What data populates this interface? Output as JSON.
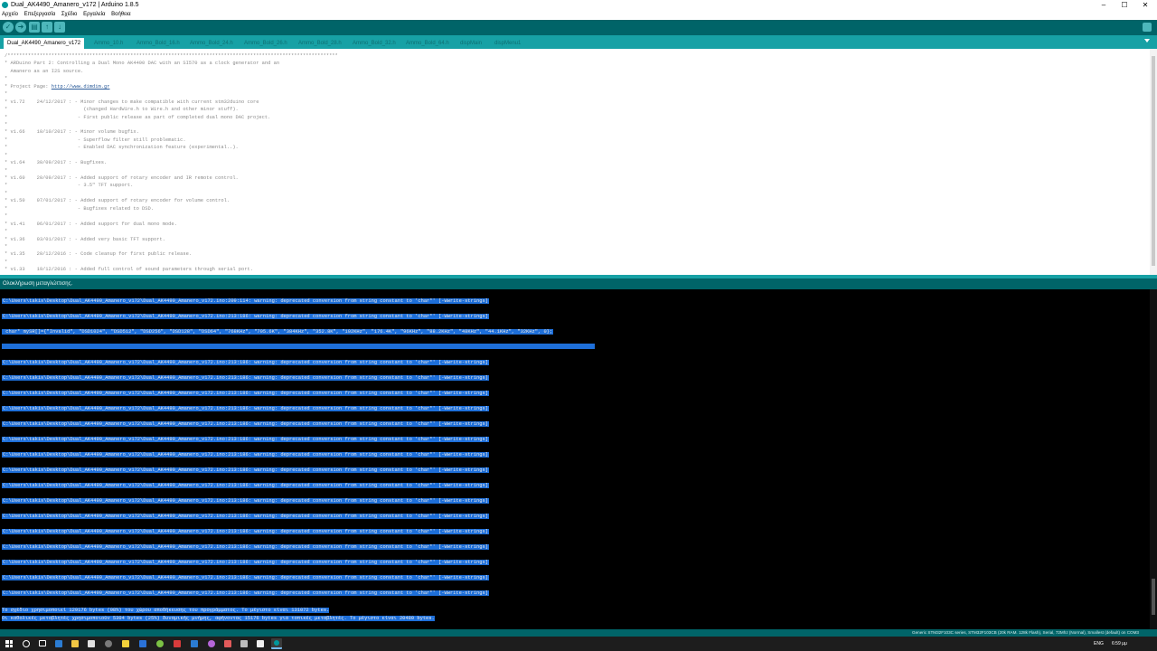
{
  "window": {
    "title": "Dual_AK4490_Amanero_v172 | Arduino 1.8.5",
    "controls": [
      "–",
      "☐",
      "✕"
    ]
  },
  "menu": [
    "Αρχείο",
    "Επεξεργασία",
    "Σχέδιο",
    "Εργαλεία",
    "Βοήθεια"
  ],
  "toolbar": {
    "verify": "✓",
    "upload": "➜",
    "new": "▤",
    "open": "↑",
    "save": "↓"
  },
  "tabs": [
    "Dual_AK4490_Amanero_v172",
    "Ammo_10.h",
    "Ammo_Bold_16.h",
    "Ammo_Bold_24.h",
    "Ammo_Bold_26.h",
    "Ammo_Bold_28.h",
    "Ammo_Bold_32.h",
    "Ammo_Bold_64.h",
    "dispMain",
    "dispMenu1"
  ],
  "code_lines": [
    "/*****************************************************************************************************************",
    "* ARDuino Part 2: Controlling a Dual Mono AK4490 DAC with an SI570 as a clock generator and an",
    "  Amanero as an I2S source.",
    "*",
    "* Project Page: ",
    "*",
    "* v1.72    24/12/2017 : - Minor changes to make compatible with current stm32duino core",
    "*                          (changed HardWire.h to Wire.h and other minor stuff).",
    "*                        - First public release as part of completed dual mono DAC project.",
    "*",
    "* v1.66    10/10/2017 : - Minor volume bugfix.",
    "*                        - Superflow filter still problematic.",
    "*                        - Enabled DAC synchronization feature (experimental..).",
    "*",
    "* v1.64    30/09/2017 : - Bugfixes.",
    "*",
    "* v1.60    20/09/2017 : - Added support of rotary encoder and IR remote control.",
    "*                        - 3.5\" TFT support.",
    "*",
    "* v1.50    07/01/2017 : - Added support of rotary encoder for volume control.",
    "*                        - Bugfixes related to DSD.",
    "*",
    "* v1.41    06/01/2017 : - Added support for dual mono mode.",
    "*",
    "* v1.36    03/01/2017 : - Added very basic TFT support.",
    "*",
    "* v1.35    20/12/2016 : - Code cleanup for first public release.",
    "*",
    "* v1.33    19/12/2016 : - Added full control of sound parameters through serial port."
  ],
  "project_link": "http://www.dimdim.gr",
  "status_message": "Ολοκλήρωση μεταγλώττισης.",
  "console_lines": [
    "C:\\Users\\takis\\Desktop\\Dual_AK4490_Amanero_v172\\Dual_AK4490_Amanero_v172.ino:209:114: warning: deprecated conversion from string constant to 'char*' [-Wwrite-strings]",
    "C:\\Users\\takis\\Desktop\\Dual_AK4490_Amanero_v172\\Dual_AK4490_Amanero_v172.ino:213:186: warning: deprecated conversion from string constant to 'char*' [-Wwrite-strings]",
    " char* mySR[]={\"Invalid\", \"DSD1024\", \"DSD512\", \"DSD256\", \"DSD128\", \"DSD64\", \"768KHz\", \"705.6K\", \"384KHz\", \"352.8K\", \"192KHz\", \"176.4K\", \"96KHz\", \"88.2KHz\", \"48KHz\", \"44.1KHz\", \"32KHz\", 0};",
    "",
    "C:\\Users\\takis\\Desktop\\Dual_AK4490_Amanero_v172\\Dual_AK4490_Amanero_v172.ino:213:186: warning: deprecated conversion from string constant to 'char*' [-Wwrite-strings]",
    "C:\\Users\\takis\\Desktop\\Dual_AK4490_Amanero_v172\\Dual_AK4490_Amanero_v172.ino:213:186: warning: deprecated conversion from string constant to 'char*' [-Wwrite-strings]",
    "C:\\Users\\takis\\Desktop\\Dual_AK4490_Amanero_v172\\Dual_AK4490_Amanero_v172.ino:213:186: warning: deprecated conversion from string constant to 'char*' [-Wwrite-strings]",
    "C:\\Users\\takis\\Desktop\\Dual_AK4490_Amanero_v172\\Dual_AK4490_Amanero_v172.ino:213:186: warning: deprecated conversion from string constant to 'char*' [-Wwrite-strings]",
    "C:\\Users\\takis\\Desktop\\Dual_AK4490_Amanero_v172\\Dual_AK4490_Amanero_v172.ino:213:186: warning: deprecated conversion from string constant to 'char*' [-Wwrite-strings]",
    "C:\\Users\\takis\\Desktop\\Dual_AK4490_Amanero_v172\\Dual_AK4490_Amanero_v172.ino:213:186: warning: deprecated conversion from string constant to 'char*' [-Wwrite-strings]",
    "C:\\Users\\takis\\Desktop\\Dual_AK4490_Amanero_v172\\Dual_AK4490_Amanero_v172.ino:213:186: warning: deprecated conversion from string constant to 'char*' [-Wwrite-strings]",
    "C:\\Users\\takis\\Desktop\\Dual_AK4490_Amanero_v172\\Dual_AK4490_Amanero_v172.ino:213:186: warning: deprecated conversion from string constant to 'char*' [-Wwrite-strings]",
    "C:\\Users\\takis\\Desktop\\Dual_AK4490_Amanero_v172\\Dual_AK4490_Amanero_v172.ino:213:186: warning: deprecated conversion from string constant to 'char*' [-Wwrite-strings]",
    "C:\\Users\\takis\\Desktop\\Dual_AK4490_Amanero_v172\\Dual_AK4490_Amanero_v172.ino:213:186: warning: deprecated conversion from string constant to 'char*' [-Wwrite-strings]",
    "C:\\Users\\takis\\Desktop\\Dual_AK4490_Amanero_v172\\Dual_AK4490_Amanero_v172.ino:213:186: warning: deprecated conversion from string constant to 'char*' [-Wwrite-strings]",
    "C:\\Users\\takis\\Desktop\\Dual_AK4490_Amanero_v172\\Dual_AK4490_Amanero_v172.ino:213:186: warning: deprecated conversion from string constant to 'char*' [-Wwrite-strings]",
    "C:\\Users\\takis\\Desktop\\Dual_AK4490_Amanero_v172\\Dual_AK4490_Amanero_v172.ino:213:186: warning: deprecated conversion from string constant to 'char*' [-Wwrite-strings]",
    "C:\\Users\\takis\\Desktop\\Dual_AK4490_Amanero_v172\\Dual_AK4490_Amanero_v172.ino:213:186: warning: deprecated conversion from string constant to 'char*' [-Wwrite-strings]",
    "C:\\Users\\takis\\Desktop\\Dual_AK4490_Amanero_v172\\Dual_AK4490_Amanero_v172.ino:213:186: warning: deprecated conversion from string constant to 'char*' [-Wwrite-strings]",
    "C:\\Users\\takis\\Desktop\\Dual_AK4490_Amanero_v172\\Dual_AK4490_Amanero_v172.ino:213:186: warning: deprecated conversion from string constant to 'char*' [-Wwrite-strings]"
  ],
  "summary_lines": [
    "Το σχέδιο χρησιμοποιεί 129176 bytes (98%) του χώρου αποθήκευσης του προγράμματος. Το μέγιστο είναι 131072 bytes.",
    "Οι καθολικές μεταβλητές χρησιμοποιούν 5304 bytes (25%) δυναμικής μνήμης, αφήνοντας 15176 bytes για τοπικές μεταβλητές. Το μέγιστο είναι 20480 bytes."
  ],
  "board_status": "Generic STM32F103C series, STM32F103CB (20k RAM. 128k Flash), Serial, 72Mhz (Normal), Smallest (default) on COM3",
  "tray": {
    "lang": "ENG",
    "time": "6:59 μμ"
  },
  "colors": {
    "accent": "#006468",
    "tab_strip": "#17a1a5",
    "selection": "#1e6fd9"
  }
}
